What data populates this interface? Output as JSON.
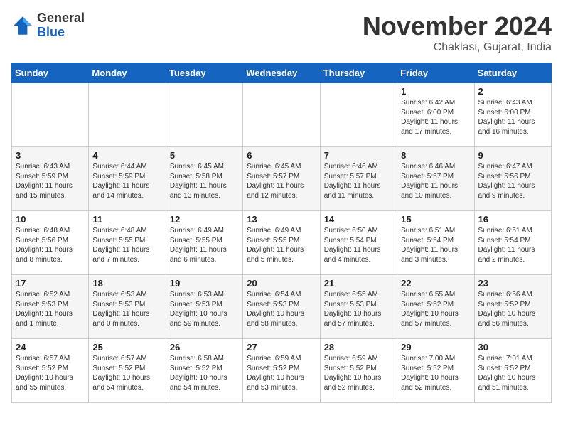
{
  "header": {
    "logo": {
      "general": "General",
      "blue": "Blue"
    },
    "title": "November 2024",
    "subtitle": "Chaklasi, Gujarat, India"
  },
  "weekdays": [
    "Sunday",
    "Monday",
    "Tuesday",
    "Wednesday",
    "Thursday",
    "Friday",
    "Saturday"
  ],
  "weeks": [
    [
      {
        "day": "",
        "text": ""
      },
      {
        "day": "",
        "text": ""
      },
      {
        "day": "",
        "text": ""
      },
      {
        "day": "",
        "text": ""
      },
      {
        "day": "",
        "text": ""
      },
      {
        "day": "1",
        "text": "Sunrise: 6:42 AM\nSunset: 6:00 PM\nDaylight: 11 hours\nand 17 minutes."
      },
      {
        "day": "2",
        "text": "Sunrise: 6:43 AM\nSunset: 6:00 PM\nDaylight: 11 hours\nand 16 minutes."
      }
    ],
    [
      {
        "day": "3",
        "text": "Sunrise: 6:43 AM\nSunset: 5:59 PM\nDaylight: 11 hours\nand 15 minutes."
      },
      {
        "day": "4",
        "text": "Sunrise: 6:44 AM\nSunset: 5:59 PM\nDaylight: 11 hours\nand 14 minutes."
      },
      {
        "day": "5",
        "text": "Sunrise: 6:45 AM\nSunset: 5:58 PM\nDaylight: 11 hours\nand 13 minutes."
      },
      {
        "day": "6",
        "text": "Sunrise: 6:45 AM\nSunset: 5:57 PM\nDaylight: 11 hours\nand 12 minutes."
      },
      {
        "day": "7",
        "text": "Sunrise: 6:46 AM\nSunset: 5:57 PM\nDaylight: 11 hours\nand 11 minutes."
      },
      {
        "day": "8",
        "text": "Sunrise: 6:46 AM\nSunset: 5:57 PM\nDaylight: 11 hours\nand 10 minutes."
      },
      {
        "day": "9",
        "text": "Sunrise: 6:47 AM\nSunset: 5:56 PM\nDaylight: 11 hours\nand 9 minutes."
      }
    ],
    [
      {
        "day": "10",
        "text": "Sunrise: 6:48 AM\nSunset: 5:56 PM\nDaylight: 11 hours\nand 8 minutes."
      },
      {
        "day": "11",
        "text": "Sunrise: 6:48 AM\nSunset: 5:55 PM\nDaylight: 11 hours\nand 7 minutes."
      },
      {
        "day": "12",
        "text": "Sunrise: 6:49 AM\nSunset: 5:55 PM\nDaylight: 11 hours\nand 6 minutes."
      },
      {
        "day": "13",
        "text": "Sunrise: 6:49 AM\nSunset: 5:55 PM\nDaylight: 11 hours\nand 5 minutes."
      },
      {
        "day": "14",
        "text": "Sunrise: 6:50 AM\nSunset: 5:54 PM\nDaylight: 11 hours\nand 4 minutes."
      },
      {
        "day": "15",
        "text": "Sunrise: 6:51 AM\nSunset: 5:54 PM\nDaylight: 11 hours\nand 3 minutes."
      },
      {
        "day": "16",
        "text": "Sunrise: 6:51 AM\nSunset: 5:54 PM\nDaylight: 11 hours\nand 2 minutes."
      }
    ],
    [
      {
        "day": "17",
        "text": "Sunrise: 6:52 AM\nSunset: 5:53 PM\nDaylight: 11 hours\nand 1 minute."
      },
      {
        "day": "18",
        "text": "Sunrise: 6:53 AM\nSunset: 5:53 PM\nDaylight: 11 hours\nand 0 minutes."
      },
      {
        "day": "19",
        "text": "Sunrise: 6:53 AM\nSunset: 5:53 PM\nDaylight: 10 hours\nand 59 minutes."
      },
      {
        "day": "20",
        "text": "Sunrise: 6:54 AM\nSunset: 5:53 PM\nDaylight: 10 hours\nand 58 minutes."
      },
      {
        "day": "21",
        "text": "Sunrise: 6:55 AM\nSunset: 5:53 PM\nDaylight: 10 hours\nand 57 minutes."
      },
      {
        "day": "22",
        "text": "Sunrise: 6:55 AM\nSunset: 5:52 PM\nDaylight: 10 hours\nand 57 minutes."
      },
      {
        "day": "23",
        "text": "Sunrise: 6:56 AM\nSunset: 5:52 PM\nDaylight: 10 hours\nand 56 minutes."
      }
    ],
    [
      {
        "day": "24",
        "text": "Sunrise: 6:57 AM\nSunset: 5:52 PM\nDaylight: 10 hours\nand 55 minutes."
      },
      {
        "day": "25",
        "text": "Sunrise: 6:57 AM\nSunset: 5:52 PM\nDaylight: 10 hours\nand 54 minutes."
      },
      {
        "day": "26",
        "text": "Sunrise: 6:58 AM\nSunset: 5:52 PM\nDaylight: 10 hours\nand 54 minutes."
      },
      {
        "day": "27",
        "text": "Sunrise: 6:59 AM\nSunset: 5:52 PM\nDaylight: 10 hours\nand 53 minutes."
      },
      {
        "day": "28",
        "text": "Sunrise: 6:59 AM\nSunset: 5:52 PM\nDaylight: 10 hours\nand 52 minutes."
      },
      {
        "day": "29",
        "text": "Sunrise: 7:00 AM\nSunset: 5:52 PM\nDaylight: 10 hours\nand 52 minutes."
      },
      {
        "day": "30",
        "text": "Sunrise: 7:01 AM\nSunset: 5:52 PM\nDaylight: 10 hours\nand 51 minutes."
      }
    ]
  ]
}
